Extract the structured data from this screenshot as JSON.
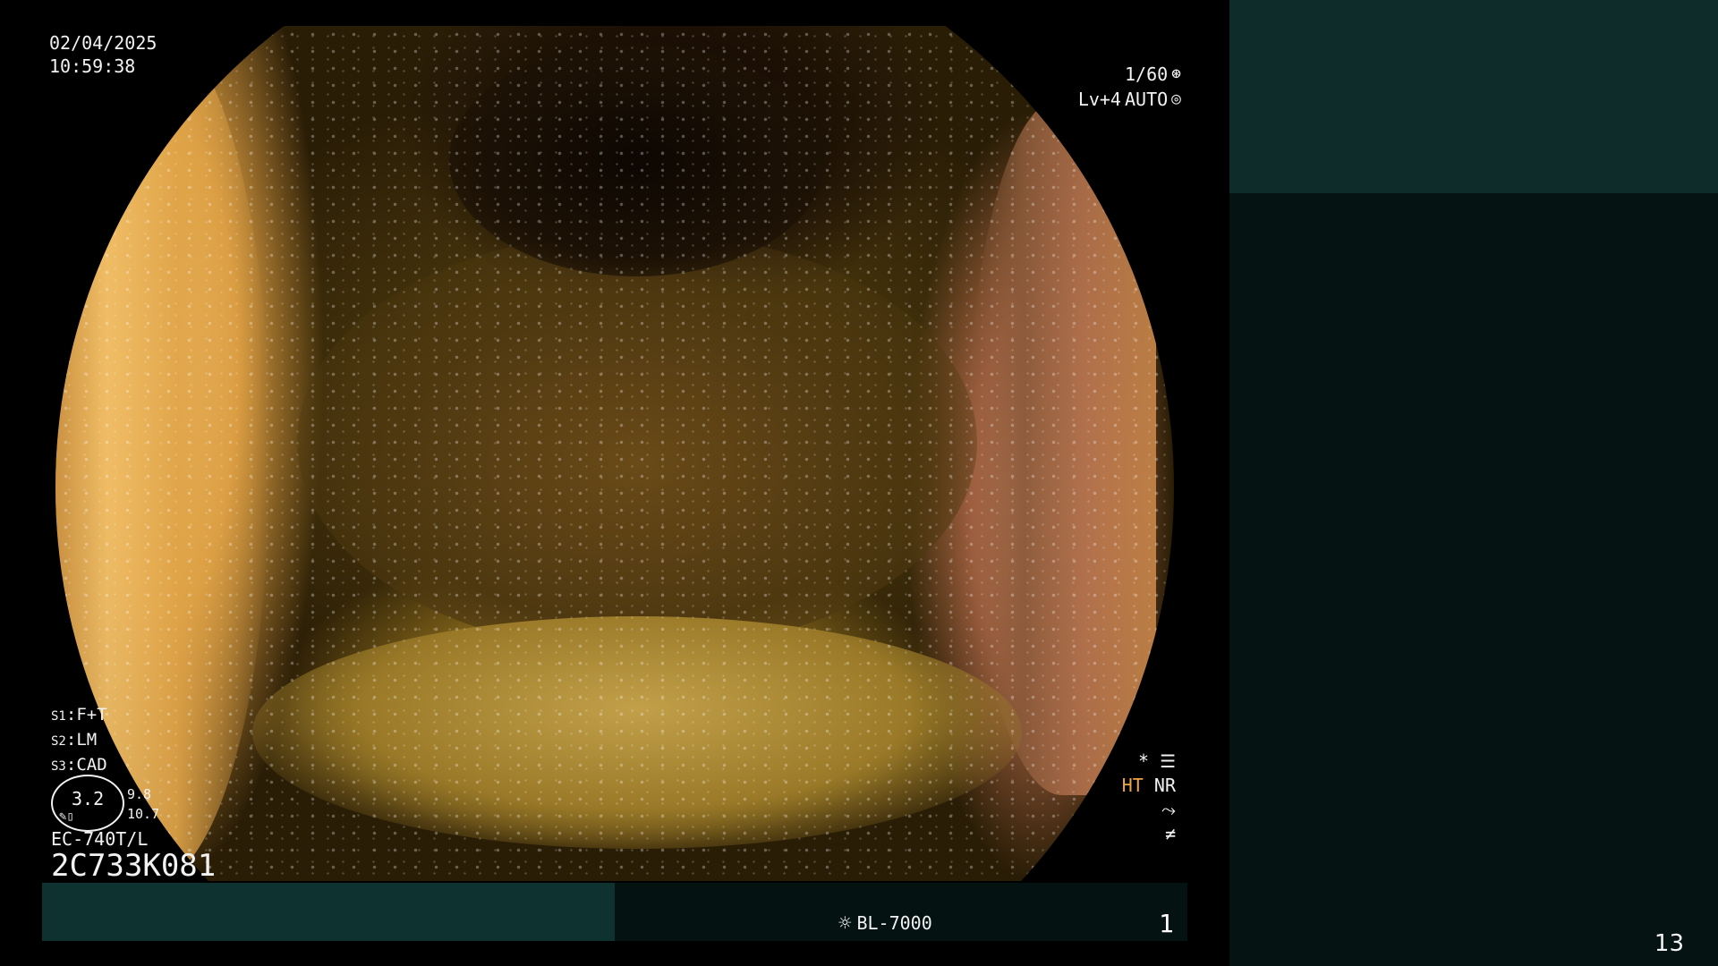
{
  "header": {
    "date": "02/04/2025",
    "time": "10:59:38"
  },
  "exposure": {
    "shutter": "1/60",
    "shutter_icon": "aperture-icon",
    "level": "Lv+4",
    "mode": "AUTO",
    "mode_icon": "iris-icon"
  },
  "switches": [
    {
      "key": "S1",
      "value": "F+T"
    },
    {
      "key": "S2",
      "value": "LM"
    },
    {
      "key": "S3",
      "value": "CAD"
    }
  ],
  "zoom": {
    "value": "3.2",
    "side_top": "9.8",
    "side_bottom": "10.7"
  },
  "scope": {
    "model": "EC-740T/L",
    "serial": "2C733K081"
  },
  "indicators": {
    "star": "*",
    "ht": "HT",
    "nr": "NR"
  },
  "bottom_bar": {
    "light_source": "BL-7000",
    "counter": "1"
  },
  "side_panel": {
    "page_number": "13"
  },
  "colors": {
    "panel_dark": "#051312",
    "panel_accent": "#0e2c2a",
    "ht_color": "#f0a640"
  }
}
